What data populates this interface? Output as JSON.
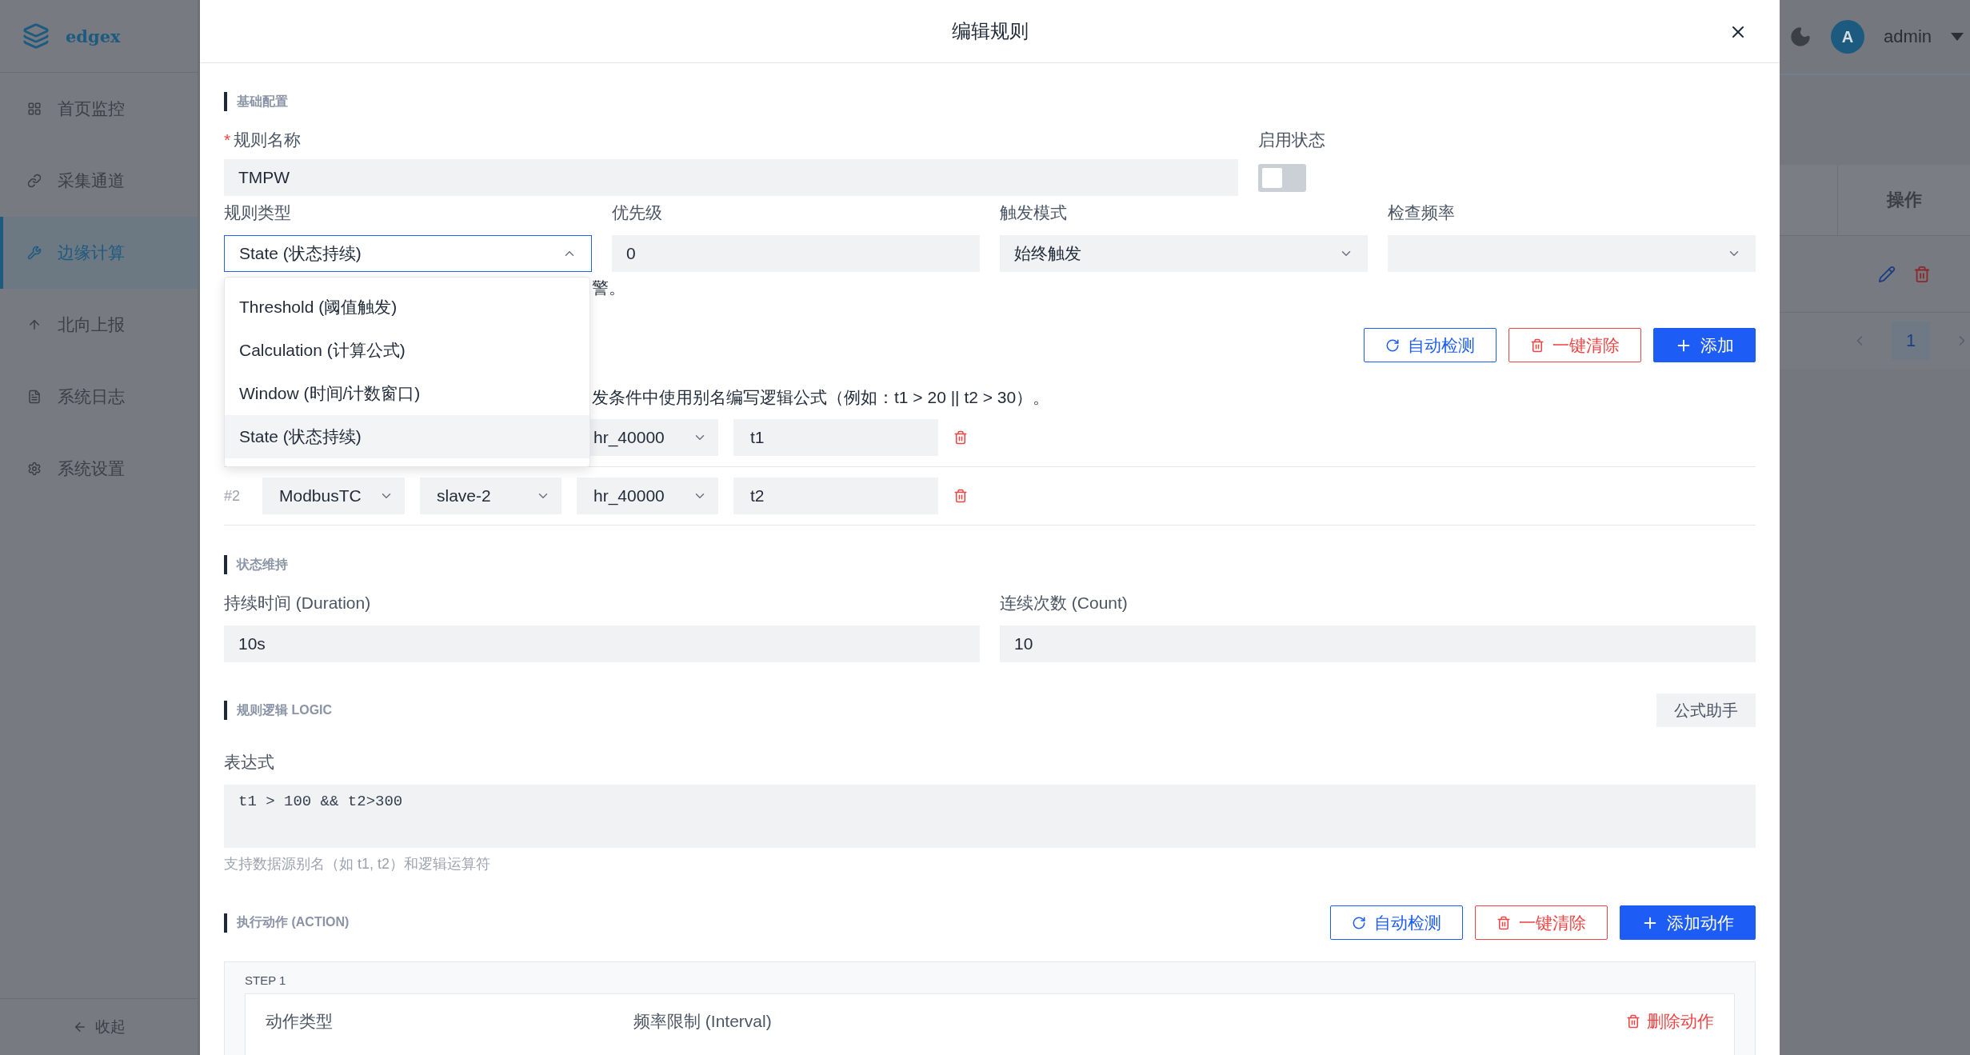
{
  "sidebar": {
    "logo": "edgex",
    "items": [
      {
        "label": "首页监控",
        "selected": false
      },
      {
        "label": "采集通道",
        "selected": false
      },
      {
        "label": "边缘计算",
        "selected": true
      },
      {
        "label": "北向上报",
        "selected": false
      },
      {
        "label": "系统日志",
        "selected": false
      },
      {
        "label": "系统设置",
        "selected": false
      }
    ],
    "collapse": "收起"
  },
  "topbar": {
    "avatar": "A",
    "user": "admin"
  },
  "table": {
    "columns": [
      "操作"
    ],
    "pagination": {
      "page": "1"
    }
  },
  "dialog": {
    "title": "编辑规则",
    "basic": {
      "title": "基础配置",
      "name": {
        "required_mark": "*",
        "label": "规则名称",
        "value": "TMPW"
      },
      "enabled": {
        "label": "启用状态",
        "on": false
      },
      "rule_type": {
        "label": "规则类型",
        "value": "State (状态持续)",
        "expanded": true,
        "options": [
          {
            "label": "Threshold (阈值触发)",
            "selected": false
          },
          {
            "label": "Calculation (计算公式)",
            "selected": false
          },
          {
            "label": "Window (时间/计数窗口)",
            "selected": false
          },
          {
            "label": "State (状态持续)",
            "selected": true
          }
        ]
      },
      "priority": {
        "label": "优先级",
        "value": "0"
      },
      "trigger_mode": {
        "label": "触发模式",
        "value": "始终触发"
      },
      "check_interval": {
        "label": "检查频率"
      },
      "hint": "警。"
    },
    "sources": {
      "buttons": [
        {
          "label": "自动检测",
          "kind": "outline"
        },
        {
          "label": "一键清除",
          "kind": "danger"
        },
        {
          "label": "添加",
          "kind": "primary"
        }
      ],
      "hint": "发条件中使用别名编写逻辑公式（例如：t1 > 20 || t2 > 30）。",
      "rows": [
        {
          "point": "hr_40000",
          "alias": "t1"
        },
        {
          "index": "#2",
          "protocol": "ModbusTC",
          "device": "slave-2",
          "point": "hr_40000",
          "alias": "t2"
        }
      ]
    },
    "state": {
      "title": "状态维持",
      "duration": {
        "label": "持续时间 (Duration)",
        "value": "10s"
      },
      "count": {
        "label": "连续次数 (Count)",
        "value": "10"
      }
    },
    "logic": {
      "title": "规则逻辑 LOGIC",
      "helper": "公式助手",
      "expression_label": "表达式",
      "expression": "t1 > 100 && t2>300",
      "hint": "支持数据源别名（如 t1, t2）和逻辑运算符"
    },
    "actions": {
      "title": "执行动作 (ACTION)",
      "buttons": [
        {
          "label": "自动检测",
          "kind": "outline"
        },
        {
          "label": "一键清除",
          "kind": "danger"
        },
        {
          "label": "添加动作",
          "kind": "primary"
        }
      ],
      "steps": [
        {
          "step": "STEP 1",
          "type_label": "动作类型",
          "interval_label": "频率限制 (Interval)",
          "delete": "删除动作"
        }
      ]
    }
  }
}
